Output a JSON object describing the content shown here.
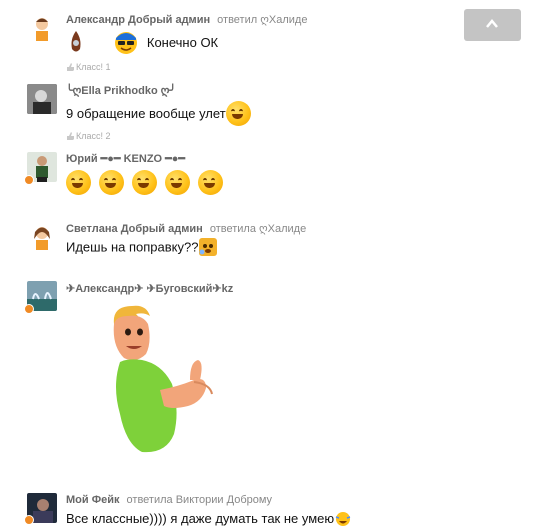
{
  "scroll_top_button": {
    "icon": "chevron-up-icon"
  },
  "comments": [
    {
      "author": "Александр Добрый админ",
      "action": "ответил",
      "target": "ღХалиде",
      "text": "Конечно ОК",
      "likes": "Класс! 1"
    },
    {
      "author": "╰ღElla Prikhodko ღ╯",
      "text": "9 обращение вообще улет",
      "likes": "Класс! 2"
    },
    {
      "author": "Юрий ━●━ KENZO ━●━"
    },
    {
      "author": "Светлана Добрый админ",
      "action": "ответила",
      "target": "ღХалиде",
      "text": "Идешь на поправку??"
    },
    {
      "author": "✈Александр✈ ✈Буговский✈kz"
    },
    {
      "author": "Мой Фейк",
      "action": "ответила",
      "target": "Виктории Доброму",
      "text": "Все классные)))) я даже думать так не умею"
    }
  ]
}
